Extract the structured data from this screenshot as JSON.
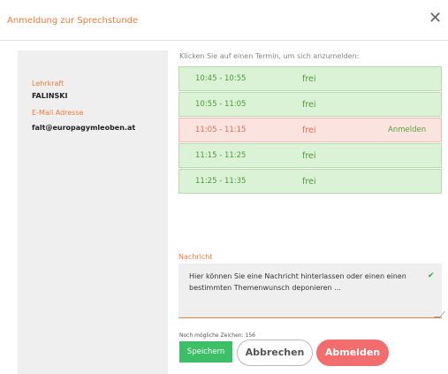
{
  "dialog": {
    "title": "Anmeldung zur Sprechstunde",
    "close_glyph": "✕"
  },
  "teacher": {
    "label_teacher": "Lehrkraft",
    "name": "FALINSKI",
    "label_email": "E-Mail Adresse",
    "email": "falt@europagymleoben.at"
  },
  "slots": {
    "instruction": "Klicken Sie auf einen Termin, um sich anzumelden:",
    "items": [
      {
        "time": "10:45 - 10:55",
        "status": "frei",
        "action": ""
      },
      {
        "time": "10:55 - 11:05",
        "status": "frei",
        "action": ""
      },
      {
        "time": "11:05 - 11:15",
        "status": "frei",
        "action": "Anmelden"
      },
      {
        "time": "11:15 - 11:25",
        "status": "frei",
        "action": ""
      },
      {
        "time": "11:25 - 11:35",
        "status": "frei",
        "action": ""
      }
    ]
  },
  "message": {
    "label": "Nachricht",
    "text": "Hier können Sie eine Nachricht hinterlassen oder einen einen bestimmten Themenwunsch deponieren ...",
    "remaining_chars": "Noch mögliche Zeichen: 156"
  },
  "buttons": {
    "save": "Speichern",
    "cancel": "Abbrechen",
    "logout": "Abmelden"
  },
  "colors": {
    "accent": "#f07b3b",
    "free": "#dcf2d6",
    "highlight": "#fbe3df",
    "save": "#3cbf67",
    "logout": "#f26d6d"
  }
}
